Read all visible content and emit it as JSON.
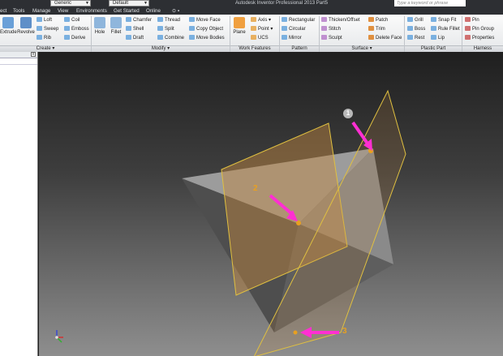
{
  "titlebar": {
    "combo_1": "Generic",
    "combo_2": "Default",
    "title": "Autodesk Inventor Professional 2013    Part5",
    "search_placeholder": "Type a keyword or phrase"
  },
  "tabs": [
    {
      "label": "ect"
    },
    {
      "label": "Tools"
    },
    {
      "label": "Manage"
    },
    {
      "label": "View"
    },
    {
      "label": "Environments"
    },
    {
      "label": "Get Started"
    },
    {
      "label": "Online"
    },
    {
      "label": "⊙ ▪"
    }
  ],
  "ribbon": {
    "create": {
      "extrude": "Extrude",
      "revolve": "Revolve",
      "loft": "Loft",
      "sweep": "Sweep",
      "rib": "Rib",
      "coil": "Coil",
      "emboss": "Emboss",
      "derive": "Derive",
      "panel": "Create ▾"
    },
    "modify": {
      "hole": "Hole",
      "fillet": "Fillet",
      "chamfer": "Chamfer",
      "shell": "Shell",
      "draft": "Draft",
      "thread": "Thread",
      "split": "Split",
      "combine": "Combine",
      "move_face": "Move Face",
      "copy_object": "Copy Object",
      "move_bodies": "Move Bodies",
      "panel": "Modify ▾"
    },
    "work_features": {
      "plane": "Plane",
      "axis": "Axis ▾",
      "point": "Point ▾",
      "ucs": "UCS",
      "panel": "Work Features"
    },
    "pattern": {
      "rectangular": "Rectangular",
      "circular": "Circular",
      "mirror": "Mirror",
      "panel": "Pattern"
    },
    "surface": {
      "thicken_offset": "Thicken/Offset",
      "stitch": "Stitch",
      "sculpt": "Sculpt",
      "patch": "Patch",
      "trim": "Trim",
      "delete_face": "Delete Face",
      "panel": "Surface ▾"
    },
    "plastic_part": {
      "grill": "Grill",
      "boss": "Boss",
      "rest": "Rest",
      "snap_fit": "Snap Fit",
      "rule_fillet": "Rule Fillet",
      "lip": "Lip",
      "panel": "Plastic Part"
    },
    "harness": {
      "pin": "Pin",
      "pin_group": "Pin Group",
      "properties": "Properties",
      "panel": "Harness"
    }
  },
  "browser": {
    "close_label": "x"
  },
  "viewport": {
    "callouts": [
      "1",
      "2",
      "3"
    ],
    "arrow_color": "#ff2fd2",
    "plane_color": "#e0c040",
    "body_color": "#a8a8a8"
  }
}
